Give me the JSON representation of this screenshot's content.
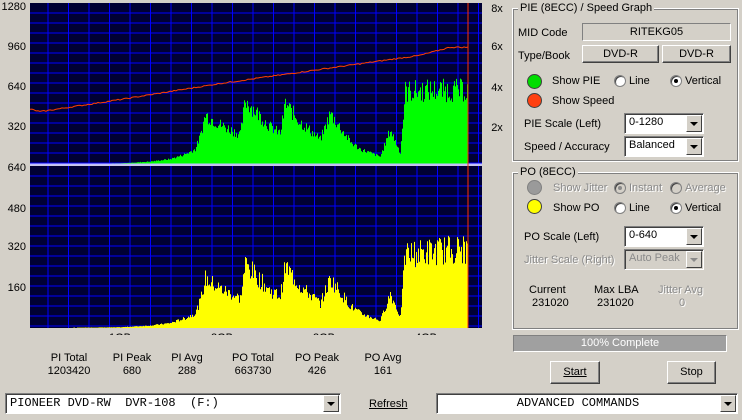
{
  "graph": {
    "pie_left_ticks": [
      "1280",
      "960",
      "640",
      "320"
    ],
    "speed_right_ticks": [
      "8x",
      "6x",
      "4x",
      "2x"
    ],
    "po_left_ticks": [
      "640",
      "480",
      "320",
      "160"
    ],
    "x_ticks": [
      "1GB",
      "2GB",
      "3GB",
      "4GB"
    ],
    "pie_color": "#00ff00",
    "speed_color": "#ff4000",
    "po_color": "#ffff00",
    "grid_color": "#0000ff",
    "background": "#000033"
  },
  "chart_data": [
    {
      "type": "area",
      "title": "PIE (8ECC) / Speed Graph",
      "xlabel": "",
      "ylabel": "",
      "x_ticks": [
        "1GB",
        "2GB",
        "3GB",
        "4GB"
      ],
      "ylim": [
        0,
        1280
      ],
      "y2lim": [
        0,
        8
      ],
      "series": [
        {
          "name": "PIE",
          "x": [
            0.0,
            0.5,
            1.0,
            1.3,
            1.5,
            1.65,
            1.75,
            1.8,
            1.85,
            2.0,
            2.2,
            2.25,
            2.5,
            2.6,
            2.65,
            2.8,
            3.0,
            3.1,
            3.3,
            3.4,
            3.6,
            3.7,
            3.8,
            3.85,
            4.1,
            4.3
          ],
          "values": [
            0,
            2,
            5,
            20,
            40,
            80,
            120,
            230,
            400,
            320,
            240,
            520,
            300,
            250,
            490,
            340,
            200,
            410,
            180,
            120,
            60,
            280,
            90,
            590,
            600,
            600
          ]
        },
        {
          "name": "Speed",
          "x": [
            0.0,
            0.05,
            0.2,
            1.0,
            2.0,
            3.0,
            4.0,
            4.3
          ],
          "values": [
            2.4,
            2.8,
            2.6,
            3.2,
            4.0,
            4.7,
            5.4,
            5.8
          ]
        }
      ],
      "grid": true
    },
    {
      "type": "area",
      "title": "PO (8ECC)",
      "xlabel": "",
      "ylabel": "",
      "x_ticks": [
        "1GB",
        "2GB",
        "3GB",
        "4GB"
      ],
      "ylim": [
        0,
        640
      ],
      "series": [
        {
          "name": "PO",
          "x": [
            0.0,
            0.5,
            1.0,
            1.3,
            1.5,
            1.65,
            1.75,
            1.8,
            1.85,
            2.0,
            2.2,
            2.25,
            2.5,
            2.6,
            2.65,
            2.8,
            3.0,
            3.1,
            3.3,
            3.4,
            3.6,
            3.7,
            3.8,
            3.85,
            4.1,
            4.3
          ],
          "values": [
            0,
            1,
            3,
            10,
            20,
            40,
            60,
            110,
            200,
            160,
            120,
            260,
            150,
            130,
            250,
            170,
            100,
            200,
            90,
            60,
            30,
            140,
            45,
            300,
            310,
            320
          ]
        }
      ],
      "grid": true
    }
  ],
  "stats": [
    {
      "label": "PI Total",
      "value": "1203420"
    },
    {
      "label": "PI Peak",
      "value": "680"
    },
    {
      "label": "PI Avg",
      "value": "288"
    },
    {
      "label": "PO Total",
      "value": "663730"
    },
    {
      "label": "PO Peak",
      "value": "426"
    },
    {
      "label": "PO Avg",
      "value": "161"
    }
  ],
  "pie_panel": {
    "title": "PIE (8ECC) / Speed Graph",
    "mid_code_label": "MID Code",
    "mid_code_value": "RITEKG05",
    "type_book_label": "Type/Book",
    "type_value": "DVD-R",
    "book_value": "DVD-R",
    "show_pie": "Show PIE",
    "line": "Line",
    "vertical": "Vertical",
    "show_speed": "Show Speed",
    "pie_scale_label": "PIE Scale (Left)",
    "pie_scale_value": "0-1280",
    "speed_accuracy_label": "Speed / Accuracy",
    "speed_accuracy_value": "Balanced"
  },
  "po_panel": {
    "title": "PO (8ECC)",
    "show_jitter": "Show Jitter",
    "instant": "Instant",
    "average": "Average",
    "show_po": "Show PO",
    "line": "Line",
    "vertical": "Vertical",
    "po_scale_label": "PO Scale (Left)",
    "po_scale_value": "0-640",
    "jitter_scale_label": "Jitter Scale (Right)",
    "jitter_scale_value": "Auto Peak",
    "current_label": "Current",
    "current_value": "231020",
    "max_lba_label": "Max LBA",
    "max_lba_value": "231020",
    "jitter_avg_label": "Jitter Avg",
    "jitter_avg_value": "0"
  },
  "progress": {
    "text": "100% Complete",
    "value": 1.0
  },
  "buttons": {
    "start": "Start",
    "stop": "Stop",
    "refresh": "Refresh"
  },
  "bottom": {
    "drive_value": "PIONEER DVD-RW  DVR-108  (F:)",
    "commands_value": "ADVANCED COMMANDS"
  },
  "colors": {
    "pie_dot": "#00dd00",
    "speed_dot": "#ff4010",
    "po_dot": "#ffff00",
    "jitter_dot": "#9a9a9a"
  }
}
